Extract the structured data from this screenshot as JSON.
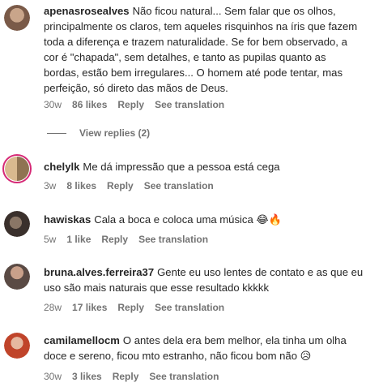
{
  "comments": [
    {
      "username": "apenasrosealves",
      "text": "Não ficou natural... Sem falar que os olhos, principalmente os claros, tem aqueles risquinhos na íris que fazem toda a diferença e trazem naturalidade. Se for bem observado, a cor é \"chapada\", sem detalhes, e tanto as pupilas quanto as bordas, estão bem irregulares... O homem até pode tentar, mas perfeição, só direto das mãos de Deus.",
      "age": "30w",
      "likes": "86 likes",
      "reply": "Reply",
      "translate": "See translation",
      "avatar_color": "#8a6a55"
    },
    {
      "username": "chelylk",
      "text": "Me dá impressão que a pessoa está cega",
      "age": "3w",
      "likes": "8 likes",
      "reply": "Reply",
      "translate": "See translation",
      "avatar_color": "#b89a70"
    },
    {
      "username": "hawiskas",
      "text": "Cala a boca e coloca uma música 😂🔥",
      "age": "5w",
      "likes": "1 like",
      "reply": "Reply",
      "translate": "See translation",
      "avatar_color": "#4a3f3a"
    },
    {
      "username": "bruna.alves.ferreira37",
      "text": "Gente eu uso lentes de contato e as que eu uso são mais naturais que esse resultado kkkkk",
      "age": "28w",
      "likes": "17 likes",
      "reply": "Reply",
      "translate": "See translation",
      "avatar_color": "#6b5a52"
    },
    {
      "username": "camilamellocm",
      "text": "O antes dela era bem melhor, ela tinha um olha doce e sereno, ficou mto estranho, não ficou bom não 😥",
      "age": "30w",
      "likes": "3 likes",
      "reply": "Reply",
      "translate": "See translation",
      "avatar_color": "#c2502e"
    }
  ],
  "view_replies": "View replies (2)"
}
